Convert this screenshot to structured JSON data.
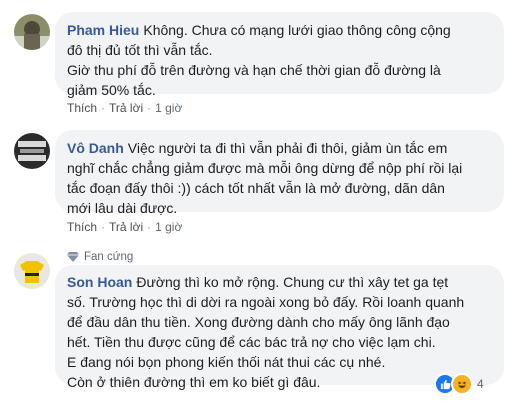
{
  "comments": [
    {
      "name": "Pham Hieu",
      "text": "Không. Chưa có mạng lưới giao thông công cộng\nđô thị đủ tốt thì vẫn tắc.\nGiờ thu phí đỗ trên đường và hạn chế thời gian đỗ đường là\ngiảm 50% tắc.",
      "like_label": "Thích",
      "reply_label": "Trả lời",
      "time": "1 giờ"
    },
    {
      "name": "Vô Danh",
      "text": "Việc người ta đi thì vẫn phải đi thôi, giảm ùn tắc em\nnghĩ chắc chẳng giảm được mà mỗi ông dừng để nộp phí rồi lại\ntắc đoạn đấy thôi :)) cách tốt nhất vẫn là mở đường, dãn dân\nmới lâu dài được.",
      "like_label": "Thích",
      "reply_label": "Trả lời",
      "time": "1 giờ"
    },
    {
      "badge": "Fan cứng",
      "name": "Son Hoan",
      "text": "Đường thì ko mở rộng. Chung cư thì xây tet ga tẹt\nsố. Trường học thì di dời ra ngoài xong bỏ đấy. Rồi loanh quanh\nđể đầu dân thu tiền. Xong đường dành cho mấy ông lãnh đạo\nhết. Tiền thu được cũng để các bác trả nợ cho việc lạm chi.\nE đang nói bọn phong kiến thối nát thui các cụ nhé.\nCòn ở thiên đường thì em ko biết gì đâu.",
      "reaction_count": "4"
    }
  ],
  "colors": {
    "name": "#385898",
    "bubble": "#f2f3f5",
    "like": "#1877f2",
    "haha": "#f7b125"
  }
}
